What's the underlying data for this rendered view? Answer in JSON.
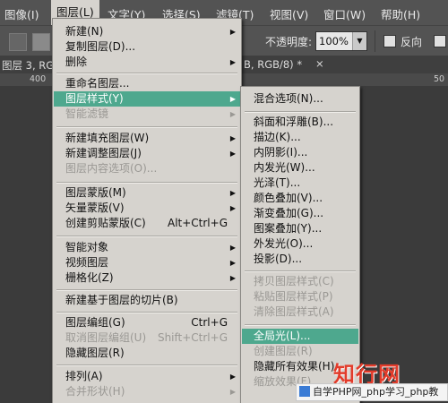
{
  "menubar": {
    "items": [
      "图像(I)",
      "图层(L)",
      "文字(Y)",
      "选择(S)",
      "滤镜(T)",
      "视图(V)",
      "窗口(W)",
      "帮助(H)"
    ],
    "active_index": 1
  },
  "options": {
    "opacity_label": "不透明度:",
    "opacity_value": "100%",
    "reverse_label": "反向"
  },
  "doc_tab": {
    "title": "图层 3, RG",
    "mode": "B, RGB/8) *",
    "close": "×"
  },
  "ruler": {
    "ticks": [
      "400",
      "50"
    ]
  },
  "layer_menu": {
    "items": [
      {
        "label": "新建(N)",
        "submenu": true
      },
      {
        "label": "复制图层(D)..."
      },
      {
        "label": "删除",
        "submenu": true
      },
      {
        "label": "重命名图层..."
      },
      {
        "label": "图层样式(Y)",
        "submenu": true,
        "highlight": true
      },
      {
        "label": "智能滤镜",
        "submenu": true,
        "disabled": true
      },
      {
        "label": "新建填充图层(W)",
        "submenu": true
      },
      {
        "label": "新建调整图层(J)",
        "submenu": true
      },
      {
        "label": "图层内容选项(O)...",
        "disabled": true
      },
      {
        "label": "图层蒙版(M)",
        "submenu": true
      },
      {
        "label": "矢量蒙版(V)",
        "submenu": true
      },
      {
        "label": "创建剪贴蒙版(C)",
        "shortcut": "Alt+Ctrl+G"
      },
      {
        "label": "智能对象",
        "submenu": true
      },
      {
        "label": "视频图层",
        "submenu": true
      },
      {
        "label": "栅格化(Z)",
        "submenu": true
      },
      {
        "label": "新建基于图层的切片(B)"
      },
      {
        "label": "图层编组(G)",
        "shortcut": "Ctrl+G"
      },
      {
        "label": "取消图层编组(U)",
        "shortcut": "Shift+Ctrl+G",
        "disabled": true
      },
      {
        "label": "隐藏图层(R)"
      },
      {
        "label": "排列(A)",
        "submenu": true
      },
      {
        "label": "合并形状(H)",
        "submenu": true,
        "disabled": true
      }
    ]
  },
  "style_menu": {
    "items": [
      {
        "label": "混合选项(N)..."
      },
      {
        "label": "斜面和浮雕(B)..."
      },
      {
        "label": "描边(K)..."
      },
      {
        "label": "内阴影(I)..."
      },
      {
        "label": "内发光(W)..."
      },
      {
        "label": "光泽(T)..."
      },
      {
        "label": "颜色叠加(V)..."
      },
      {
        "label": "渐变叠加(G)..."
      },
      {
        "label": "图案叠加(Y)..."
      },
      {
        "label": "外发光(O)..."
      },
      {
        "label": "投影(D)..."
      },
      {
        "label": "拷贝图层样式(C)",
        "disabled": true
      },
      {
        "label": "粘贴图层样式(P)",
        "disabled": true
      },
      {
        "label": "清除图层样式(A)",
        "disabled": true
      },
      {
        "label": "全局光(L)...",
        "highlight": true
      },
      {
        "label": "创建图层(R)",
        "disabled": true
      },
      {
        "label": "隐藏所有效果(H)"
      },
      {
        "label": "缩放效果(F)...",
        "disabled": true
      }
    ]
  },
  "watermark": {
    "logo": "知行网",
    "banner": "自学PHP网_php学习_php教"
  },
  "colors": {
    "highlight": "#4ea88e",
    "menu_bg": "#d6d3ce",
    "app_bg": "#535353"
  }
}
